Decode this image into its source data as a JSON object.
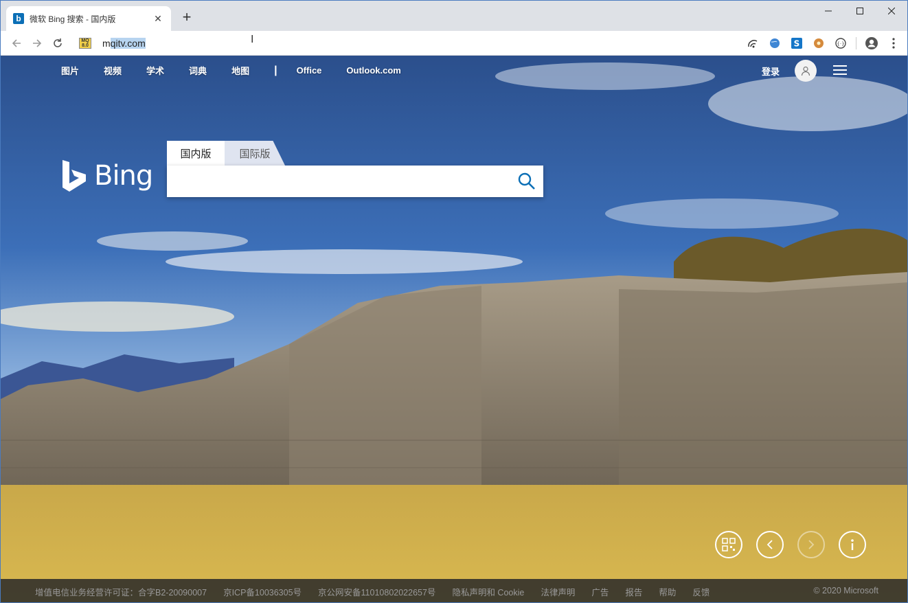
{
  "browser": {
    "tab_title": "微软 Bing 搜索 - 国内版",
    "tab_favicon": "b",
    "new_tab": "+",
    "url_prefix": "m",
    "url_selected": "qitv.com",
    "site_icon_text": "MQ 8.0"
  },
  "page": {
    "topnav": [
      "图片",
      "视频",
      "学术",
      "词典",
      "地图"
    ],
    "topnav_divider": "|",
    "topnav_extra": [
      "Office",
      "Outlook.com"
    ],
    "login": "登录",
    "logo_word": "Bing",
    "search_tabs": {
      "domestic": "国内版",
      "international": "国际版"
    },
    "search_placeholder": ""
  },
  "footer": {
    "links": [
      "增值电信业务经营许可证：合字B2-20090007",
      "京ICP备10036305号",
      "京公网安备11010802022657号",
      "隐私声明和 Cookie",
      "法律声明",
      "广告",
      "报告",
      "帮助",
      "反馈"
    ],
    "copyright": "© 2020 Microsoft"
  },
  "colors": {
    "bing_blue": "#0c6fb6",
    "toolbar_bg": "#dee1e6"
  }
}
